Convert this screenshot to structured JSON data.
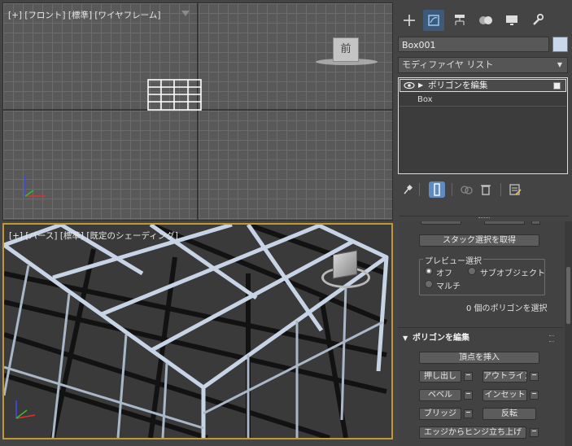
{
  "viewports": {
    "front": {
      "label": "[+] [フロント] [標準] [ワイヤフレーム]",
      "viewcube_label": "前"
    },
    "perspective": {
      "label": "[+] [パース] [標準] [既定のシェーディング]"
    }
  },
  "panel": {
    "tabs": [
      {
        "name": "create-tab",
        "icon": "plus-icon"
      },
      {
        "name": "modify-tab",
        "icon": "modify-icon"
      },
      {
        "name": "hierarchy-tab",
        "icon": "hierarchy-icon"
      },
      {
        "name": "motion-tab",
        "icon": "motion-icon"
      },
      {
        "name": "display-tab",
        "icon": "display-icon"
      },
      {
        "name": "utilities-tab",
        "icon": "wrench-icon"
      }
    ],
    "object_name": "Box001",
    "object_color": "#c9d7ec",
    "modifier_list": "モディファイヤ リスト",
    "stack": [
      {
        "label": "ポリゴンを編集"
      },
      {
        "label": "Box"
      }
    ]
  },
  "rollout_selection": {
    "get_stack_selection": "スタック選択を取得",
    "preview_group": "プレビュー選択",
    "radio_off": "オフ",
    "radio_subobject": "サブオブジェクト",
    "radio_multi": "マルチ",
    "status": "0 個のポリゴンを選択"
  },
  "rollout_edit_polygons": {
    "title": "ポリゴンを編集",
    "insert_vertex": "頂点を挿入",
    "extrude": "押し出し",
    "outline": "アウトライン",
    "bevel": "ベベル",
    "inset": "インセット",
    "bridge": "ブリッジ",
    "flip": "反転",
    "hinge_from_edge": "エッジからヒンジ立ち上げ"
  },
  "colors": {
    "active_viewport_border": "#c09a31",
    "active_tab": "#3d5a78"
  }
}
